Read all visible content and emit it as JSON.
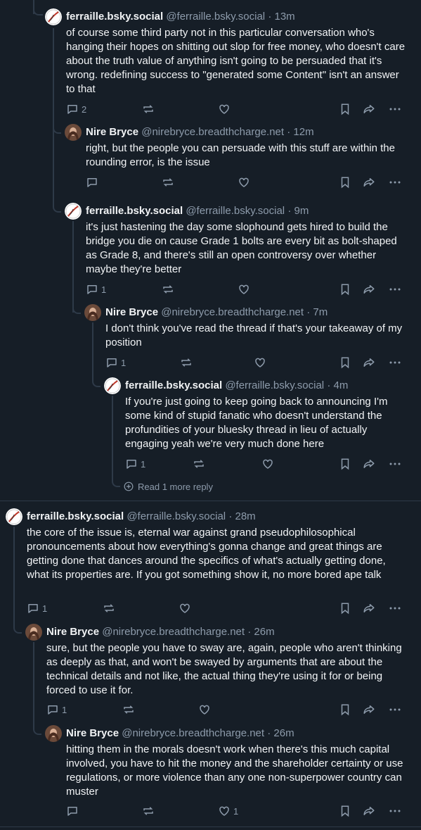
{
  "posts": [
    {
      "name": "ferraille.bsky.social",
      "handle": "@ferraille.bsky.social",
      "sep": "·",
      "time": "13m",
      "text": "of course some third party not in this particular conversation who's hanging their hopes on shitting out slop for free money, who doesn't care about the truth value of anything isn't going to be persuaded that it's wrong. redefining success to \"generated some Content\" isn't an answer to that",
      "replies": "2",
      "likes": ""
    },
    {
      "name": "Nire Bryce",
      "handle": "@nirebryce.breadthcharge.net",
      "sep": "·",
      "time": "12m",
      "text": "right, but the people you can persuade with this stuff are within the rounding error, is the issue",
      "replies": "",
      "likes": ""
    },
    {
      "name": "ferraille.bsky.social",
      "handle": "@ferraille.bsky.social",
      "sep": "·",
      "time": "9m",
      "text": "it's just hastening the day some slophound gets hired to build the bridge you die on cause Grade 1 bolts are every bit as bolt-shaped as Grade 8, and there's still an open controversy over whether maybe they're better",
      "replies": "1",
      "likes": ""
    },
    {
      "name": "Nire Bryce",
      "handle": "@nirebryce.breadthcharge.net",
      "sep": "·",
      "time": "7m",
      "text": "I don't think you've read the thread if that's your takeaway of my position",
      "replies": "1",
      "likes": ""
    },
    {
      "name": "ferraille.bsky.social",
      "handle": "@ferraille.bsky.social",
      "sep": "·",
      "time": "4m",
      "text": "If you're just going to keep going back to announcing I'm some kind of stupid fanatic who doesn't understand the profundities of your bluesky thread in lieu of actually engaging yeah we're very much done here",
      "replies": "1",
      "likes": ""
    },
    {
      "name": "ferraille.bsky.social",
      "handle": "@ferraille.bsky.social",
      "sep": "·",
      "time": "28m",
      "text": "the core of the issue is, eternal war against grand pseudophilosophical pronouncements about how everything's gonna change and great things are getting done that dances around the specifics of what's actually getting done, what its properties are. If you got something show it, no more bored ape talk",
      "replies": "1",
      "likes": ""
    },
    {
      "name": "Nire Bryce",
      "handle": "@nirebryce.breadthcharge.net",
      "sep": "·",
      "time": "26m",
      "text": "sure, but the people you have to sway are, again, people who aren't thinking as deeply as that, and won't be swayed by arguments that are about the technical details and not like, the actual thing they're using it for or being forced to use it for.",
      "replies": "1",
      "likes": ""
    },
    {
      "name": "Nire Bryce",
      "handle": "@nirebryce.breadthcharge.net",
      "sep": "·",
      "time": "26m",
      "text": "hitting them in the morals doesn't work when there's this much capital involved, you have to hit the money and the shareholder certainty or use regulations, or more violence than any one non-superpower country can muster",
      "replies": "",
      "likes": "1"
    }
  ],
  "read_more": "Read 1 more reply",
  "icons": {
    "reply": "reply-icon",
    "repost": "repost-icon",
    "like": "like-icon",
    "bookmark": "bookmark-icon",
    "share": "share-icon",
    "more": "more-icon"
  },
  "colors": {
    "background": "#161e27",
    "muted": "#8d9bab",
    "line": "#2e3a48",
    "text": "#f1f3f5"
  }
}
